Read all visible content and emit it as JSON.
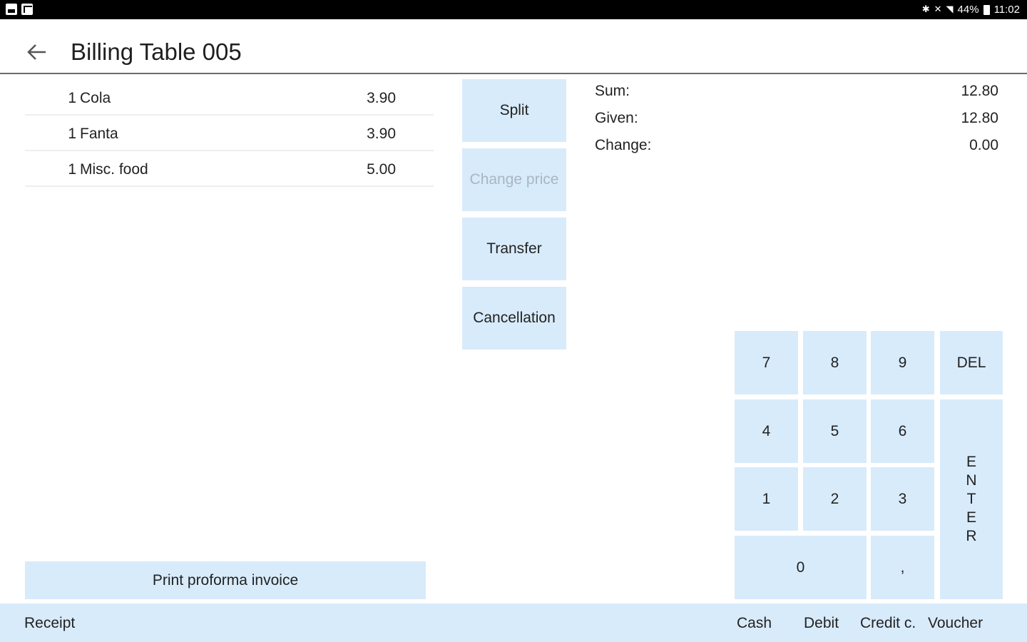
{
  "status_bar": {
    "left_icons": [
      "photo-icon",
      "note-icon"
    ],
    "right_icons": [
      "bluetooth-icon",
      "mute-icon",
      "wifi-icon",
      "battery-icon"
    ],
    "battery_text": "44%",
    "time": "11:02"
  },
  "header": {
    "back_icon": "arrow-left-icon",
    "title": "Billing Table 005"
  },
  "order_items": [
    {
      "qty": "1",
      "name": "Cola",
      "price": "3.90"
    },
    {
      "qty": "1",
      "name": "Fanta",
      "price": "3.90"
    },
    {
      "qty": "1",
      "name": "Misc. food",
      "price": "5.00"
    }
  ],
  "actions": {
    "split": "Split",
    "change_price": "Change price",
    "transfer": "Transfer",
    "cancellation": "Cancellation"
  },
  "summary": {
    "sum_label": "Sum:",
    "sum_value": "12.80",
    "given_label": "Given:",
    "given_value": "12.80",
    "change_label": "Change:",
    "change_value": "0.00"
  },
  "keypad": {
    "k7": "7",
    "k8": "8",
    "k9": "9",
    "del": "DEL",
    "k4": "4",
    "k5": "5",
    "k6": "6",
    "k1": "1",
    "k2": "2",
    "k3": "3",
    "k0": "0",
    "comma": ",",
    "enter_letters": [
      "E",
      "N",
      "T",
      "E",
      "R"
    ]
  },
  "proforma_button": "Print proforma invoice",
  "bottom_bar": {
    "receipt": "Receipt",
    "cash": "Cash",
    "debit": "Debit",
    "credit": "Credit c.",
    "voucher": "Voucher"
  },
  "colors": {
    "accent_light_blue": "#d8ebfb",
    "disabled_text": "#a9b6c2",
    "status_bar": "#000000"
  }
}
